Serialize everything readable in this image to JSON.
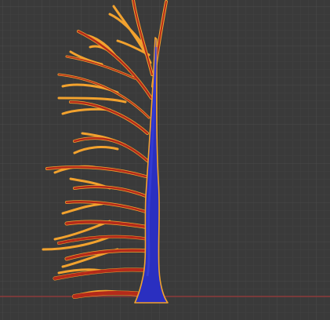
{
  "viewport": {
    "kind": "3d-viewport",
    "background": "#3a3a3a",
    "grid_minor_color": "#414141",
    "grid_major_color": "#4a4a4a",
    "axis_x_color": "#8a3a3a"
  },
  "model": {
    "name": "tree",
    "colors": {
      "trunk": "#2a2fc0",
      "trunk_outline": "#f0a030",
      "branch_core": "#b02818",
      "branch_mid": "#d84820",
      "branch_outline": "#f0a030"
    }
  }
}
